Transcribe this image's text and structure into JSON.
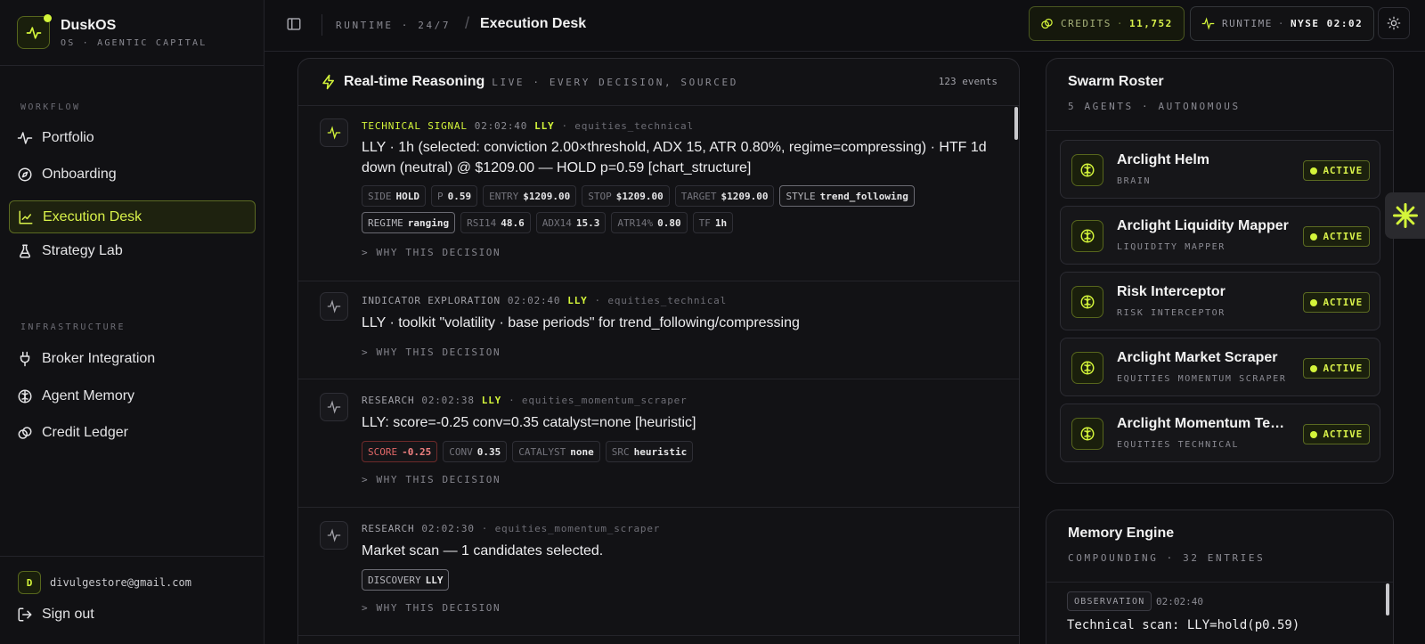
{
  "brand": {
    "name": "DuskOS",
    "subtitle": "OS · AGENTIC CAPITAL"
  },
  "sidebar": {
    "sections": [
      {
        "label": "WORKFLOW",
        "items": [
          {
            "label": "Portfolio",
            "icon": "activity-icon"
          },
          {
            "label": "Onboarding",
            "icon": "compass-icon"
          },
          {
            "label": "Execution Desk",
            "icon": "chart-line-icon",
            "active": true
          },
          {
            "label": "Strategy Lab",
            "icon": "flask-icon"
          }
        ]
      },
      {
        "label": "INFRASTRUCTURE",
        "items": [
          {
            "label": "Broker Integration",
            "icon": "plug-icon"
          },
          {
            "label": "Agent Memory",
            "icon": "brain-icon"
          },
          {
            "label": "Credit Ledger",
            "icon": "coins-icon"
          }
        ]
      }
    ],
    "user": {
      "initial": "D",
      "email": "divulgestore@gmail.com"
    },
    "signout_label": "Sign out"
  },
  "topbar": {
    "crumb_parent": "RUNTIME · 24/7",
    "crumb_current": "Execution Desk",
    "credits_label": "CREDITS",
    "credits_value": "11,752",
    "runtime_label": "RUNTIME",
    "runtime_value": "NYSE 02:02"
  },
  "feed": {
    "title": "Real-time Reasoning",
    "subtitle": "LIVE · EVERY DECISION, SOURCED",
    "count": "123 events",
    "why_label": "WHY THIS DECISION",
    "events": [
      {
        "kind": "TECHNICAL SIGNAL",
        "time": "02:02:40",
        "ticker": "LLY",
        "source": "· equities_technical",
        "text": "LLY · 1h (selected: conviction 2.00×threshold, ADX 15, ATR 0.80%, regime=compressing) · HTF 1d down (neutral) @ $1209.00 — HOLD p=0.59 [chart_structure]",
        "tags": [
          {
            "k": "SIDE",
            "v": "HOLD"
          },
          {
            "k": "P",
            "v": "0.59"
          },
          {
            "k": "ENTRY",
            "v": "$1209.00"
          },
          {
            "k": "STOP",
            "v": "$1209.00"
          },
          {
            "k": "TARGET",
            "v": "$1209.00"
          },
          {
            "k": "STYLE",
            "v": "trend_following",
            "hl": true
          },
          {
            "k": "REGIME",
            "v": "ranging",
            "hl": true
          },
          {
            "k": "RSI14",
            "v": "48.6"
          },
          {
            "k": "ADX14",
            "v": "15.3"
          },
          {
            "k": "ATR14%",
            "v": "0.80"
          },
          {
            "k": "TF",
            "v": "1h"
          }
        ]
      },
      {
        "kind": "INDICATOR EXPLORATION",
        "time": "02:02:40",
        "ticker": "LLY",
        "source": "· equities_technical",
        "text": "LLY · toolkit \"volatility · base periods\" for trend_following/compressing",
        "tags": []
      },
      {
        "kind": "RESEARCH",
        "time": "02:02:38",
        "ticker": "LLY",
        "source": "· equities_momentum_scraper",
        "text": "LLY: score=-0.25 conv=0.35 catalyst=none [heuristic]",
        "tags": [
          {
            "k": "SCORE",
            "v": "-0.25",
            "neg": true
          },
          {
            "k": "CONV",
            "v": "0.35"
          },
          {
            "k": "CATALYST",
            "v": "none"
          },
          {
            "k": "SRC",
            "v": "heuristic"
          }
        ]
      },
      {
        "kind": "RESEARCH",
        "time": "02:02:30",
        "ticker": "",
        "source": "· equities_momentum_scraper",
        "text": "Market scan — 1 candidates selected.",
        "tags": [
          {
            "k": "DISCOVERY",
            "v": "LLY",
            "hl": true
          }
        ]
      }
    ]
  },
  "roster": {
    "title": "Swarm Roster",
    "subtitle": "5 AGENTS · AUTONOMOUS",
    "agents": [
      {
        "name": "Arclight Helm",
        "role": "BRAIN",
        "status": "ACTIVE"
      },
      {
        "name": "Arclight Liquidity Mapper",
        "role": "LIQUIDITY MAPPER",
        "status": "ACTIVE"
      },
      {
        "name": "Risk Interceptor",
        "role": "RISK INTERCEPTOR",
        "status": "ACTIVE"
      },
      {
        "name": "Arclight Market Scraper",
        "role": "EQUITIES MOMENTUM SCRAPER",
        "status": "ACTIVE"
      },
      {
        "name": "Arclight Momentum Technical",
        "role": "EQUITIES TECHNICAL",
        "status": "ACTIVE"
      }
    ]
  },
  "memory": {
    "title": "Memory Engine",
    "subtitle": "COMPOUNDING · 32 ENTRIES",
    "entry": {
      "tag": "OBSERVATION",
      "time": "02:02:40",
      "text": "Technical scan: LLY=hold(p0.59)"
    }
  },
  "colors": {
    "accent": "#d4f53a",
    "background": "#0e0e11",
    "negative": "#e06767"
  }
}
